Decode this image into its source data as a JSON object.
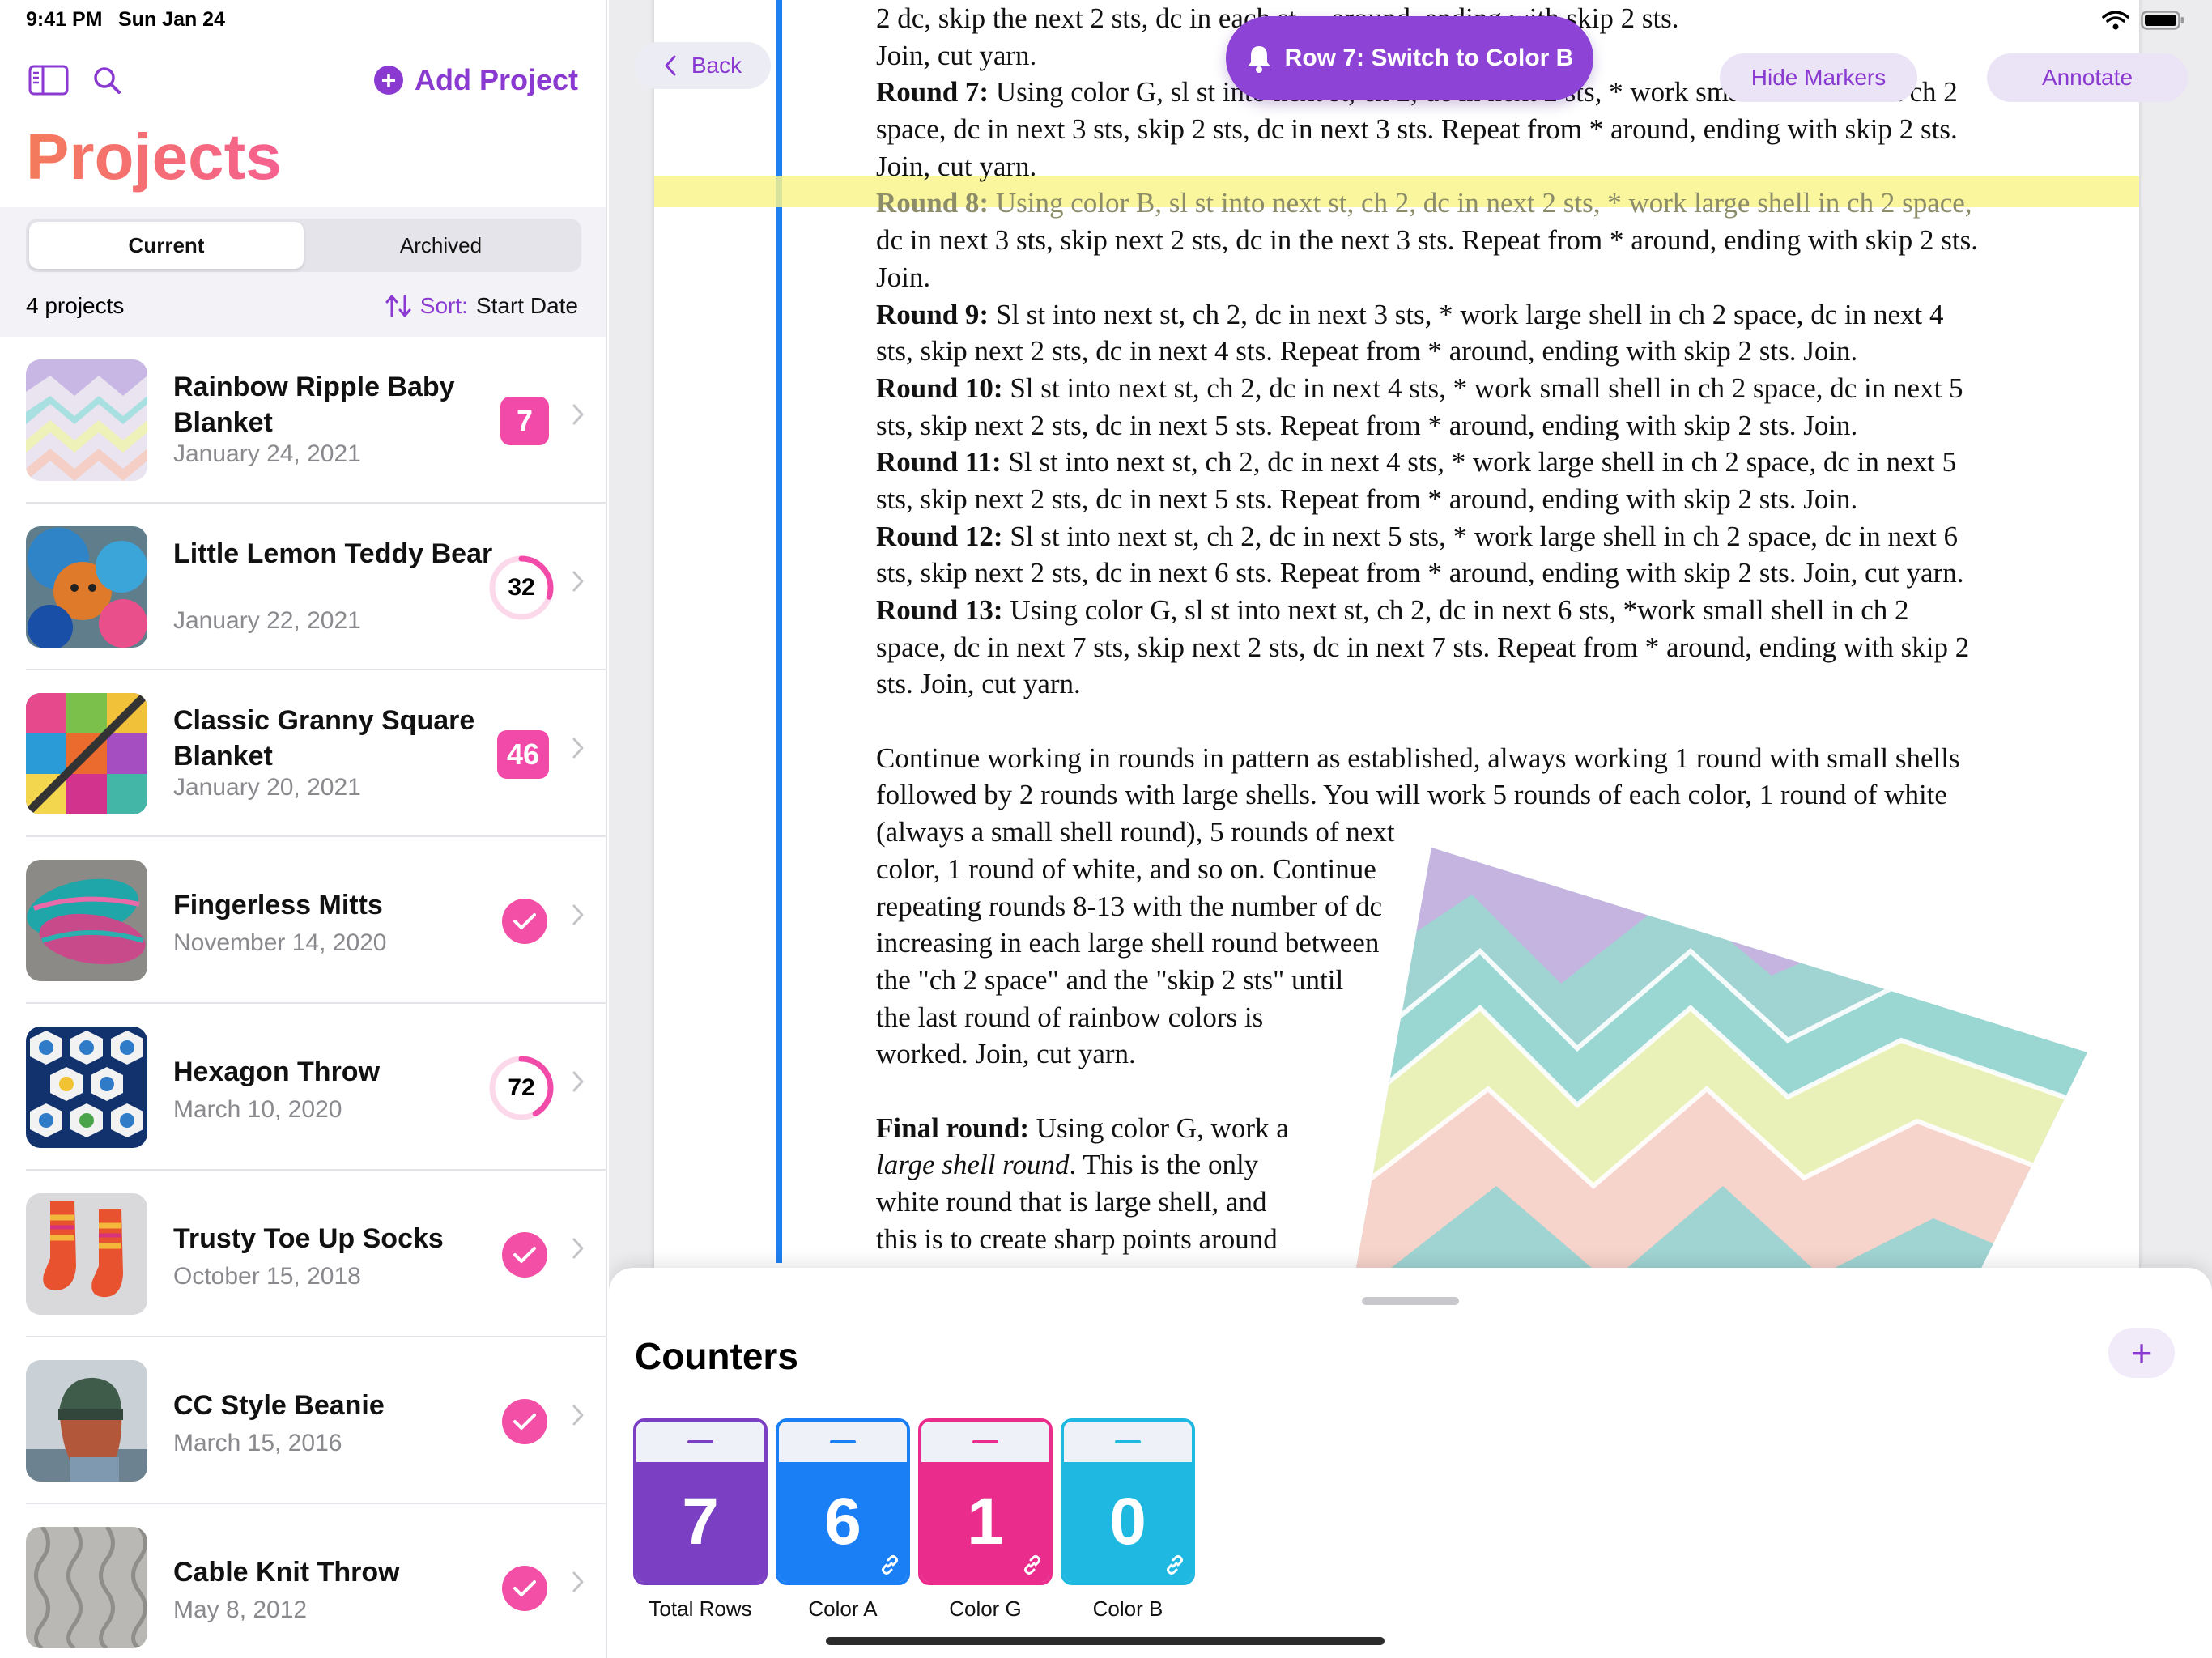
{
  "status_bar": {
    "time": "9:41 PM",
    "date": "Sun Jan 24"
  },
  "sidebar": {
    "title": "Projects",
    "add_project_label": "Add Project",
    "tabs": [
      {
        "label": "Current"
      },
      {
        "label": "Archived"
      }
    ],
    "project_count": "4 projects",
    "sort_prefix": "Sort:",
    "sort_value": "Start Date",
    "projects": [
      {
        "name": "Rainbow Ripple Baby Blanket",
        "date": "January 24, 2021",
        "badge": "7",
        "badge_type": "square"
      },
      {
        "name": "Little Lemon Teddy Bear",
        "date": "January 22, 2021",
        "badge": "32",
        "badge_type": "ring",
        "progress": 0.3
      },
      {
        "name": "Classic Granny Square Blanket",
        "date": "January 20, 2021",
        "badge": "46",
        "badge_type": "square"
      },
      {
        "name": "Fingerless Mitts",
        "date": "November 14, 2020",
        "badge_type": "check"
      },
      {
        "name": "Hexagon Throw",
        "date": "March 10, 2020",
        "badge": "72",
        "badge_type": "ring",
        "progress": 0.42
      },
      {
        "name": "Trusty Toe Up Socks",
        "date": "October 15, 2018",
        "badge_type": "check"
      },
      {
        "name": "CC Style Beanie",
        "date": "March 15, 2016",
        "badge_type": "check"
      },
      {
        "name": "Cable Knit Throw",
        "date": "May 8, 2012",
        "badge_type": "check"
      }
    ]
  },
  "toolbar": {
    "back_label": "Back",
    "hide_markers_label": "Hide Markers",
    "annotate_label": "Annotate",
    "reminder_label": "Row 7: Switch to Color B"
  },
  "document": {
    "lines": [
      {
        "text": "2 dc, skip the next 2 sts, dc in each st ... around, ending with skip 2 sts."
      },
      {
        "text": "Join, cut yarn."
      },
      {
        "bold": "Round 7:",
        "text": " Using color G, sl st into next st, ch 2, dc in next 2 sts, * work small shell in next ch 2"
      },
      {
        "text": "space, dc in next 3 sts, skip 2 sts, dc in next 3 sts. Repeat from * around, ending with skip 2 sts."
      },
      {
        "text": "Join, cut yarn."
      },
      {
        "bold": "Round 8:",
        "text": " Using color B, sl st into next st, ch 2, dc in next 2 sts, * work large shell in ch 2 space,",
        "highlight": true
      },
      {
        "text": "dc in next 3 sts, skip next 2 sts, dc in the next 3 sts. Repeat from * around, ending with skip 2 sts."
      },
      {
        "text": "Join."
      },
      {
        "bold": "Round 9:",
        "text": " Sl st into next st, ch 2, dc in next 3 sts, * work large shell in ch 2 space, dc in next 4"
      },
      {
        "text": "sts, skip next 2 sts, dc in next 4 sts. Repeat from * around, ending with skip 2 sts. Join."
      },
      {
        "bold": "Round 10:",
        "text": " Sl st into next st, ch 2, dc in next 4 sts, * work small shell in ch 2 space, dc in next 5"
      },
      {
        "text": "sts, skip next 2 sts, dc in next 5 sts. Repeat from * around, ending with skip 2 sts. Join."
      },
      {
        "bold": "Round 11:",
        "text": " Sl st into next st, ch 2, dc in next 4 sts, * work large shell in ch 2 space, dc in next 5"
      },
      {
        "text": "sts, skip next 2 sts, dc in next 5 sts. Repeat from * around, ending with skip 2 sts. Join."
      },
      {
        "bold": "Round 12:",
        "text": " Sl st into next st, ch 2, dc in next 5 sts, * work large shell in ch 2 space, dc in next 6"
      },
      {
        "text": "sts, skip next 2 sts, dc in next 6 sts. Repeat from * around, ending with skip 2 sts. Join, cut yarn."
      },
      {
        "bold": "Round 13:",
        "text": " Using color G, sl st into next st, ch 2, dc in next 6 sts, *work small shell in ch 2"
      },
      {
        "text": "space, dc in next 7 sts, skip next 2 sts, dc in next 7 sts. Repeat from * around, ending with skip 2"
      },
      {
        "text": "sts. Join, cut yarn."
      },
      {
        "gap": true
      },
      {
        "text": "Continue working in rounds in pattern as established, always working 1 round with small shells"
      },
      {
        "text": "followed by 2 rounds with large shells. You will work 5 rounds of each color, 1 round of white"
      },
      {
        "text": "(always a small shell round), 5 rounds of next"
      },
      {
        "text": "color, 1 round of white, and so on. Continue"
      },
      {
        "text": "repeating rounds 8-13 with the number of dc"
      },
      {
        "text": "increasing in each large shell round between"
      },
      {
        "text": "the \"ch 2 space\" and the \"skip 2 sts\" until"
      },
      {
        "text": "the last round of rainbow colors is"
      },
      {
        "text": "worked.  Join, cut yarn."
      },
      {
        "gap": true
      },
      {
        "bold": "Final round:",
        "text": " Using color G, work a"
      },
      {
        "italic": "large shell round",
        "text": ". This is the only"
      },
      {
        "text": "white round that is large shell, and"
      },
      {
        "text": "this is to create sharp points around"
      }
    ]
  },
  "counters": {
    "title": "Counters",
    "items": [
      {
        "label": "Total Rows",
        "value": "7",
        "color": "#7b3fc4",
        "linked": false
      },
      {
        "label": "Color A",
        "value": "6",
        "color": "#1a7ef5",
        "linked": true
      },
      {
        "label": "Color G",
        "value": "1",
        "color": "#ea2c8c",
        "linked": true
      },
      {
        "label": "Color B",
        "value": "0",
        "color": "#1fb8e0",
        "linked": true
      }
    ]
  },
  "colors": {
    "accent": "#8a3ad0",
    "pink": "#f24aa8",
    "title_gradient_start": "#f47b5b",
    "title_gradient_end": "#f5608f"
  }
}
